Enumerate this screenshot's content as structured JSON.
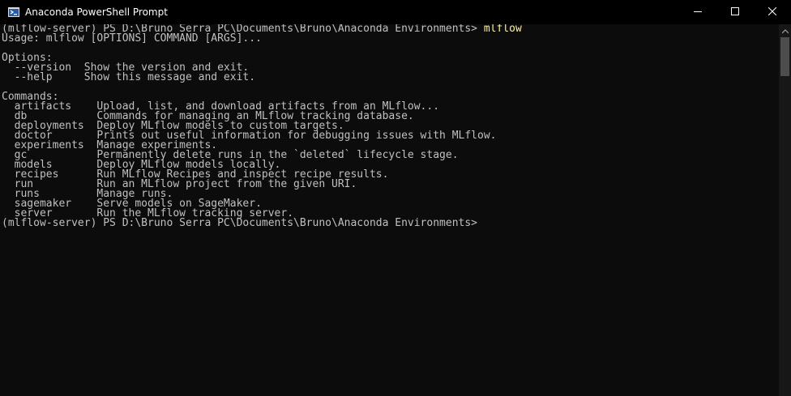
{
  "window": {
    "title": "Anaconda PowerShell Prompt",
    "icon": "powershell-icon",
    "minimize_icon": "minimize-icon",
    "maximize_icon": "maximize-icon",
    "close_icon": "close-icon"
  },
  "colors": {
    "background": "#0c0c0c",
    "text": "#c0c0c0",
    "command_highlight": "#f9f1a5",
    "titlebar": "#000000"
  },
  "console": {
    "prompt1": "(mlflow-server) PS D:\\Bruno Serra PC\\Documents\\Bruno\\Anaconda Environments> ",
    "command1": "mlflow",
    "usage": "Usage: mlflow [OPTIONS] COMMAND [ARGS]...",
    "blank": "",
    "options_header": "Options:",
    "options": [
      "  --version  Show the version and exit.",
      "  --help     Show this message and exit."
    ],
    "commands_header": "Commands:",
    "commands": [
      "  artifacts    Upload, list, and download artifacts from an MLflow...",
      "  db           Commands for managing an MLflow tracking database.",
      "  deployments  Deploy MLflow models to custom targets.",
      "  doctor       Prints out useful information for debugging issues with MLflow.",
      "  experiments  Manage experiments.",
      "  gc           Permanently delete runs in the `deleted` lifecycle stage.",
      "  models       Deploy MLflow models locally.",
      "  recipes      Run MLflow Recipes and inspect recipe results.",
      "  run          Run an MLflow project from the given URI.",
      "  runs         Manage runs.",
      "  sagemaker    Serve models on SageMaker.",
      "  server       Run the MLflow tracking server."
    ],
    "prompt2": "(mlflow-server) PS D:\\Bruno Serra PC\\Documents\\Bruno\\Anaconda Environments>"
  }
}
